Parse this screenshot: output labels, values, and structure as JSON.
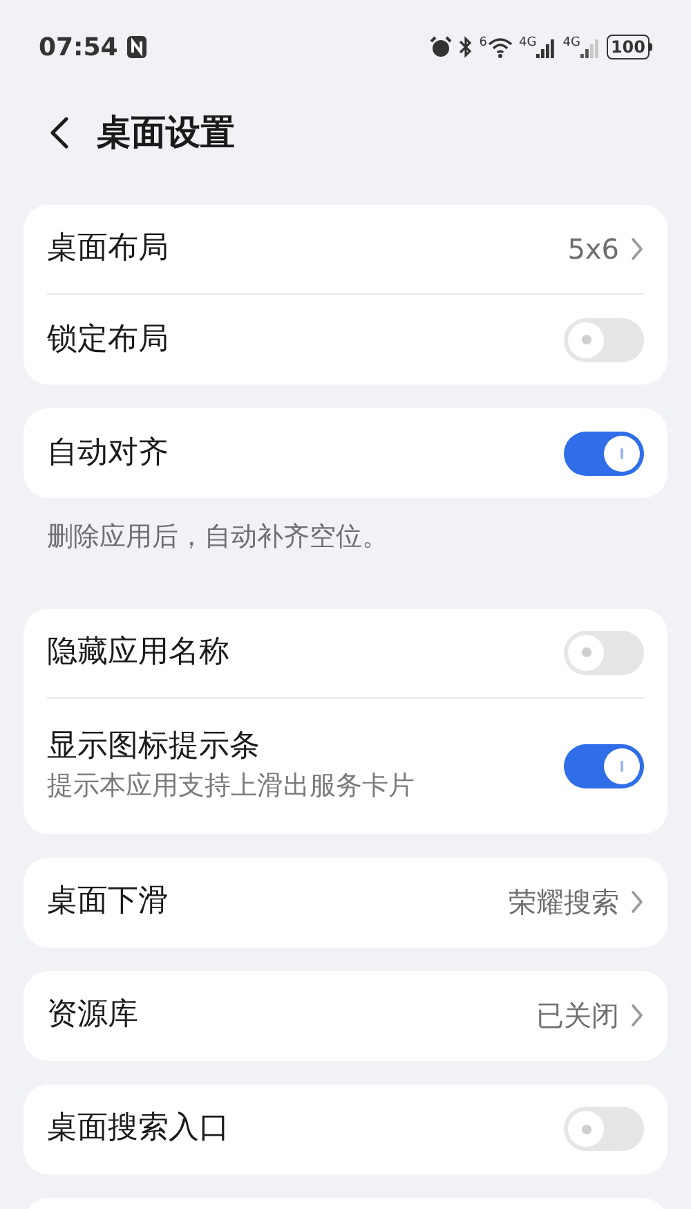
{
  "status_bar": {
    "time": "07:54",
    "wifi_badge": "6",
    "sim_labels": [
      "4G",
      "4G"
    ],
    "battery": "100"
  },
  "header": {
    "title": "桌面设置"
  },
  "groups": [
    {
      "rows": [
        {
          "kind": "value",
          "label": "桌面布局",
          "value": "5x6"
        },
        {
          "kind": "toggle",
          "label": "锁定布局",
          "on": false
        }
      ]
    },
    {
      "rows": [
        {
          "kind": "toggle",
          "label": "自动对齐",
          "on": true
        }
      ],
      "footnote": "删除应用后，自动补齐空位。"
    },
    {
      "rows": [
        {
          "kind": "toggle",
          "label": "隐藏应用名称",
          "on": false
        },
        {
          "kind": "toggle",
          "label": "显示图标提示条",
          "subtitle": "提示本应用支持上滑出服务卡片",
          "on": true
        }
      ]
    },
    {
      "rows": [
        {
          "kind": "value",
          "label": "桌面下滑",
          "value": "荣耀搜索"
        }
      ]
    },
    {
      "rows": [
        {
          "kind": "value",
          "label": "资源库",
          "value": "已关闭"
        }
      ]
    },
    {
      "rows": [
        {
          "kind": "toggle",
          "label": "桌面搜索入口",
          "on": false
        }
      ]
    },
    {
      "kind": "empty"
    }
  ]
}
